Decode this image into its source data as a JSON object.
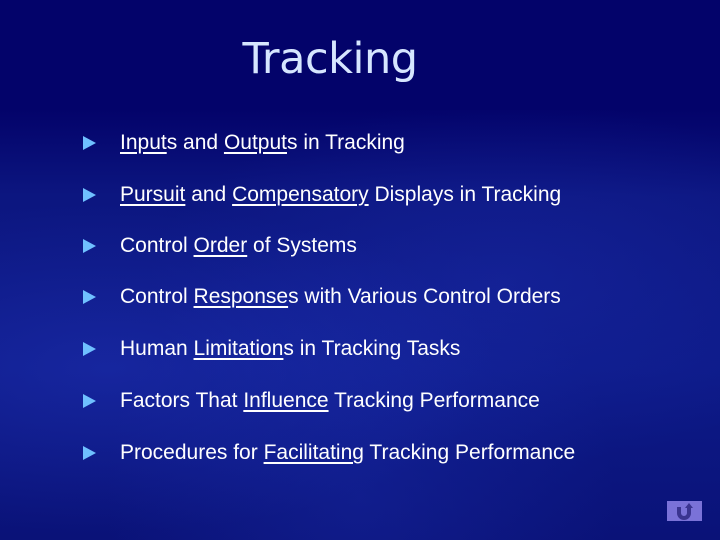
{
  "slide": {
    "title": "Tracking",
    "bullets": [
      {
        "parts": [
          {
            "t": "Input",
            "u": true
          },
          {
            "t": "s and ",
            "u": false
          },
          {
            "t": "Output",
            "u": true
          },
          {
            "t": "s in Tracking",
            "u": false
          }
        ]
      },
      {
        "parts": [
          {
            "t": "Pursuit",
            "u": true
          },
          {
            "t": " and ",
            "u": false
          },
          {
            "t": "Compensatory",
            "u": true
          },
          {
            "t": " Displays in Tracking",
            "u": false
          }
        ]
      },
      {
        "parts": [
          {
            "t": "Control ",
            "u": false
          },
          {
            "t": "Order",
            "u": true
          },
          {
            "t": " of Systems",
            "u": false
          }
        ]
      },
      {
        "parts": [
          {
            "t": "Control ",
            "u": false
          },
          {
            "t": "Response",
            "u": true
          },
          {
            "t": "s with Various Control Orders",
            "u": false
          }
        ]
      },
      {
        "parts": [
          {
            "t": "Human ",
            "u": false
          },
          {
            "t": "Limitation",
            "u": true
          },
          {
            "t": "s in Tracking Tasks",
            "u": false
          }
        ]
      },
      {
        "parts": [
          {
            "t": "Factors That ",
            "u": false
          },
          {
            "t": "Influence",
            "u": true
          },
          {
            "t": " Tracking Performance",
            "u": false
          }
        ]
      },
      {
        "parts": [
          {
            "t": "Procedures for ",
            "u": false
          },
          {
            "t": "Facilitating",
            "u": true
          },
          {
            "t": " Tracking Performance",
            "u": false
          }
        ]
      }
    ],
    "bullet_icon": "triangle-right-icon",
    "return_button_icon": "return-arrow-icon",
    "colors": {
      "background": "#03036a",
      "title": "#d6e6ff",
      "bullet_arrow": "#6fc0ff",
      "text": "#ffffff",
      "button": "#7a72d8"
    }
  }
}
